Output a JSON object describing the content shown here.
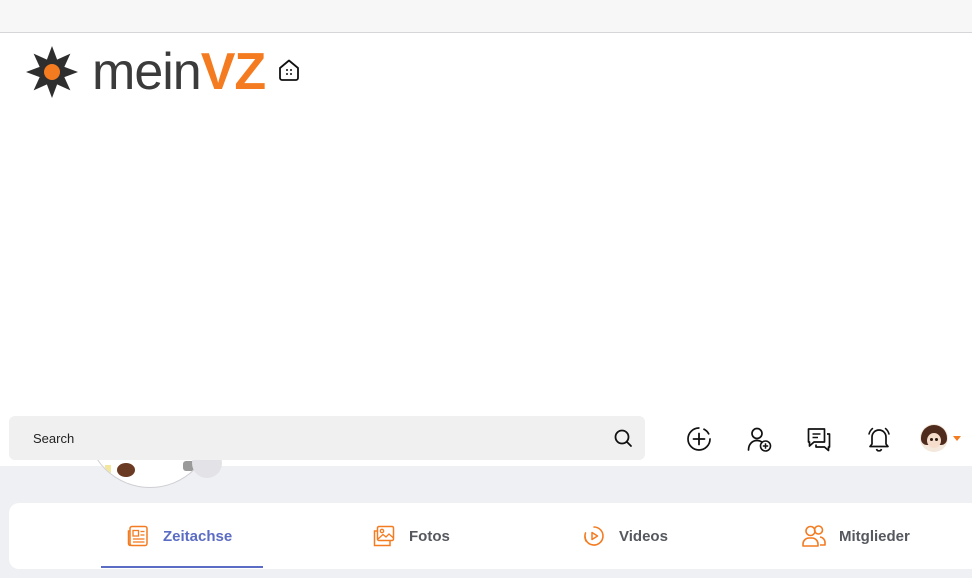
{
  "brand": {
    "name_part1": "mein",
    "name_part2": "VZ"
  },
  "search": {
    "placeholder": "Search"
  },
  "header_actions": [
    {
      "icon": "add-circle-icon"
    },
    {
      "icon": "add-friend-icon"
    },
    {
      "icon": "messages-icon"
    },
    {
      "icon": "notification-bell-icon"
    }
  ],
  "tabs": [
    {
      "label": "Zeitachse",
      "icon": "timeline-icon",
      "active": true
    },
    {
      "label": "Fotos",
      "icon": "photos-icon",
      "active": false
    },
    {
      "label": "Videos",
      "icon": "videos-icon",
      "active": false
    },
    {
      "label": "Mitglieder",
      "icon": "members-icon",
      "active": false
    }
  ],
  "colors": {
    "accent": "#f47b20",
    "active_tab": "#5b6cc4",
    "text": "#55585f"
  }
}
